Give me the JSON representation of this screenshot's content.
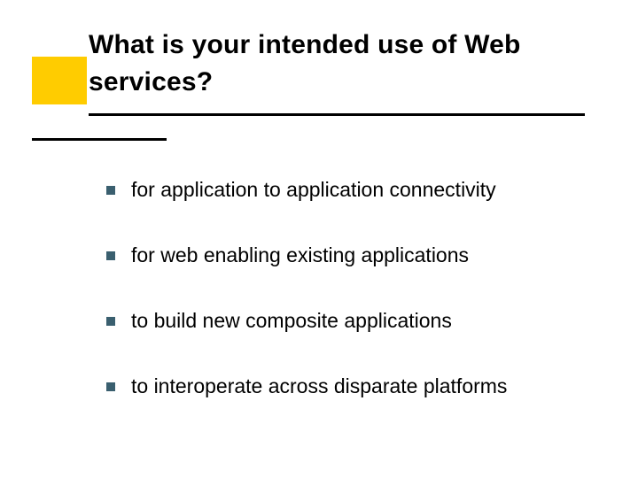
{
  "title": "What is your intended use of Web services?",
  "bullets": [
    "for application to application connectivity",
    "for web enabling existing applications",
    "to build new composite applications",
    "to interoperate across disparate platforms"
  ]
}
